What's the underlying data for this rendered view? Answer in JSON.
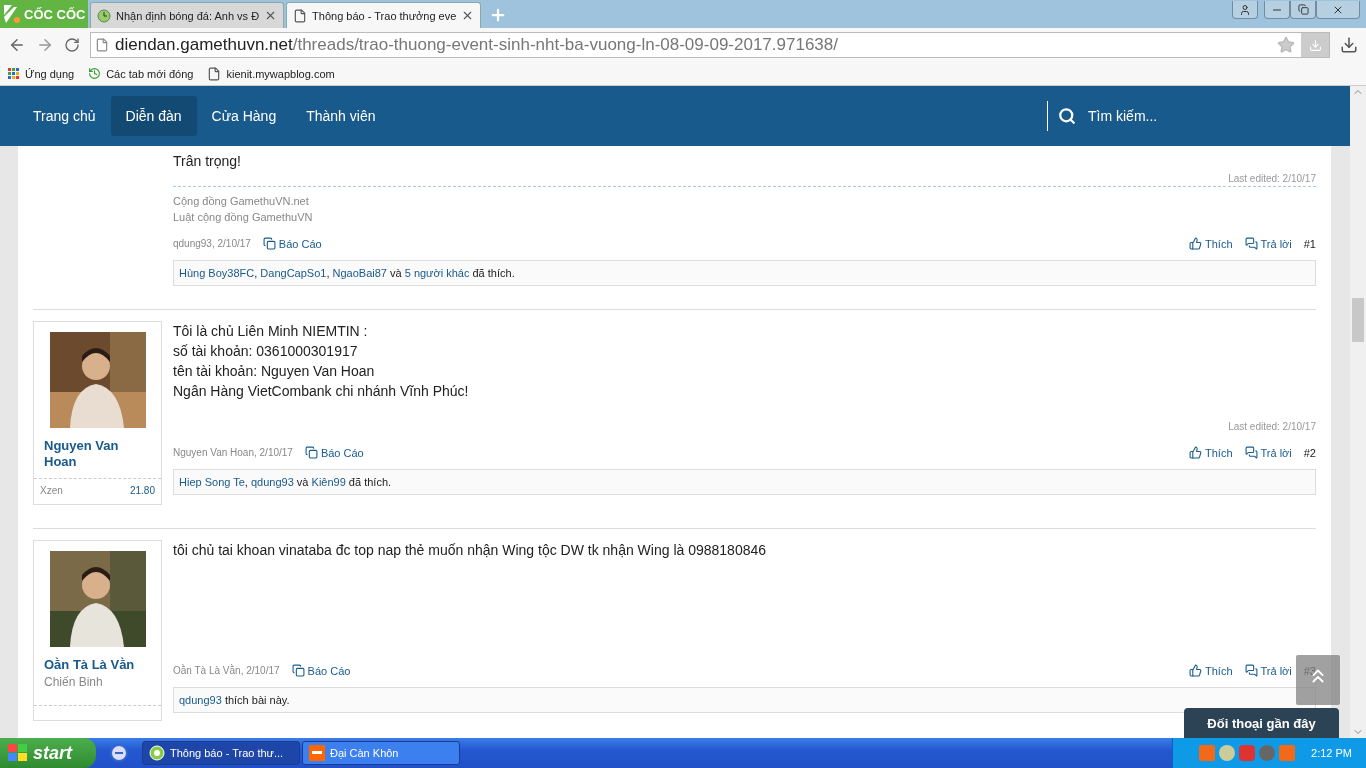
{
  "browser": {
    "brand": "CỐC CỐC",
    "tabs": [
      {
        "title": "Nhận định bóng đá: Anh vs Đ",
        "selected": false
      },
      {
        "title": "Thông báo - Trao thưởng eve",
        "selected": true
      }
    ],
    "url_host": "diendan.gamethuvn.net",
    "url_path": "/threads/trao-thuong-event-sinh-nht-ba-vuong-ln-08-09-09-2017.971638/",
    "bookmarks": [
      {
        "label": "Ứng dụng"
      },
      {
        "label": "Các tab mới đóng"
      },
      {
        "label": "kienit.mywapblog.com"
      }
    ]
  },
  "nav": {
    "items": [
      {
        "label": "Trang chủ",
        "selected": false
      },
      {
        "label": "Diễn đàn",
        "selected": true
      },
      {
        "label": "Cửa Hàng",
        "selected": false
      },
      {
        "label": "Thành viên",
        "selected": false
      }
    ],
    "search": {
      "placeholder": "Tìm kiếm..."
    }
  },
  "posts": [
    {
      "lines": [
        "Trân trọng!"
      ],
      "last_edited": "Last edited: 2/10/17",
      "signature": [
        "Cộng đồng GamethuVN.net",
        "Luật cộng đồng GamethuVN"
      ],
      "meta": "qdung93, 2/10/17",
      "report": "Báo Cáo",
      "like": "Thích",
      "reply": "Trả lời",
      "number": "#1",
      "likes": [
        {
          "kind": "link",
          "text": "Hùng Boy38FC"
        },
        {
          "kind": "text",
          "text": ", "
        },
        {
          "kind": "link",
          "text": "DangCapSo1"
        },
        {
          "kind": "text",
          "text": ", "
        },
        {
          "kind": "link",
          "text": "NgaoBai87"
        },
        {
          "kind": "text",
          "text": " và "
        },
        {
          "kind": "link",
          "text": "5 người khác"
        },
        {
          "kind": "text",
          "text": " đã thích."
        }
      ]
    },
    {
      "user": {
        "name": "Nguyen Van Hoan",
        "stat_label": "Xzen",
        "stat_value": "21.80"
      },
      "lines": [
        "Tôi là chủ Liên Minh NIEMTIN :",
        "số tài khoản: 0361000301917",
        "tên tài khoản: Nguyen Van Hoan",
        "Ngân Hàng VietCombank chi nhánh Vĩnh Phúc!"
      ],
      "last_edited": "Last edited: 2/10/17",
      "meta": "Nguyen Van Hoan, 2/10/17",
      "report": "Báo Cáo",
      "like": "Thích",
      "reply": "Trả lời",
      "number": "#2",
      "likes": [
        {
          "kind": "link",
          "text": "Hiep Song Te"
        },
        {
          "kind": "text",
          "text": ", "
        },
        {
          "kind": "link",
          "text": "qdung93"
        },
        {
          "kind": "text",
          "text": " và "
        },
        {
          "kind": "link",
          "text": "Kiên99"
        },
        {
          "kind": "text",
          "text": " đã thích."
        }
      ]
    },
    {
      "user": {
        "name": "Oằn Tà Là Vằn",
        "title": "Chiến Binh"
      },
      "lines": [
        "tôi chủ tai khoan vinataba đc top nap thẻ muốn nhận Wing tộc DW tk nhận Wing là 0988180846"
      ],
      "meta": "Oằn Tà Là Vằn, 2/10/17",
      "report": "Báo Cáo",
      "like": "Thích",
      "reply": "Trả lời",
      "number": "#3",
      "likes": [
        {
          "kind": "link",
          "text": "qdung93"
        },
        {
          "kind": "text",
          "text": " thích bài này."
        }
      ]
    }
  ],
  "chat_panel": {
    "title": "Đối thoại gần đây"
  },
  "taskbar": {
    "start": "start",
    "tasks": [
      {
        "label": "Thông báo - Trao thư...",
        "selected": true
      },
      {
        "label": "Đại Càn Khôn",
        "selected": false
      }
    ],
    "clock": "2:12 PM"
  }
}
